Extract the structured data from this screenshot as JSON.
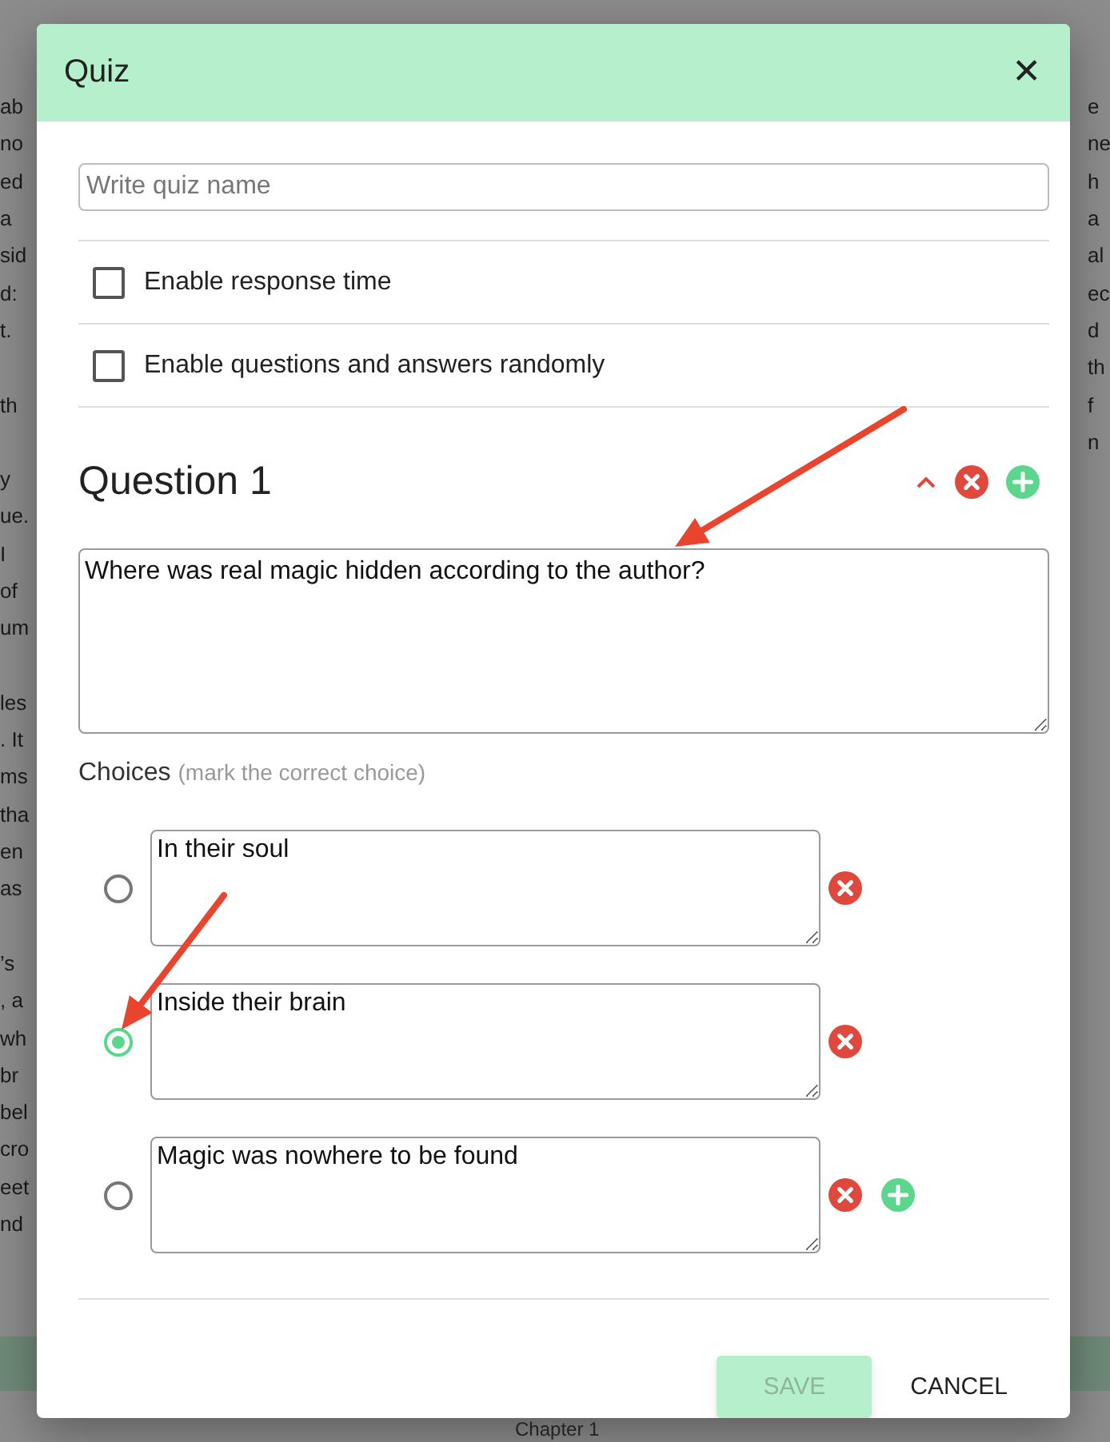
{
  "background": {
    "lines": [
      {
        "left": "ab",
        "right": "e"
      },
      {
        "left": "no",
        "right": "ne"
      },
      {
        "left": "ed",
        "right": "h"
      },
      {
        "left": "a",
        "right": "a"
      },
      {
        "left": "sid",
        "right": "al"
      },
      {
        "left": "d:",
        "right": "ec"
      },
      {
        "left": "t.",
        "right": "d"
      },
      {
        "right": "th"
      },
      {
        "left": "th",
        "right": "f"
      },
      {
        "right": "n"
      },
      {
        "left": "y"
      },
      {
        "left": "ue."
      },
      {
        "left": "I"
      },
      {
        "left": "of"
      },
      {
        "left": "um"
      },
      {
        "left": "les",
        "space_before": true
      },
      {
        "left": ". It"
      },
      {
        "left": "ms"
      },
      {
        "left": "tha"
      },
      {
        "left": "en"
      },
      {
        "left": "as"
      },
      {
        "left": "’s",
        "space_before": true
      },
      {
        "left": ", a"
      },
      {
        "left": "wh"
      },
      {
        "left": "br"
      },
      {
        "left": "bel"
      },
      {
        "left": "cro"
      },
      {
        "left": "eet"
      },
      {
        "left": "nd"
      }
    ],
    "footer_caption": "Chapter 1"
  },
  "dialog": {
    "title": "Quiz",
    "close": "✕",
    "quiz_name": {
      "placeholder": "Write quiz name"
    },
    "options": [
      {
        "label": "Enable response time",
        "checked": false
      },
      {
        "label": "Enable questions and answers randomly",
        "checked": false
      }
    ],
    "question": {
      "title": "Question 1",
      "expanded": true,
      "text": "Where was real magic hidden according to the author?",
      "choices_label": "Choices",
      "choices_hint": "(mark the correct choice)",
      "choices": [
        {
          "text": "In their soul",
          "selected": false
        },
        {
          "text": "Inside their brain",
          "selected": true
        },
        {
          "text": "Magic was nowhere to be found",
          "selected": false
        }
      ]
    },
    "buttons": [
      {
        "label": "SAVE",
        "kind": "primary",
        "disabled": true
      },
      {
        "label": "CANCEL",
        "kind": "text",
        "disabled": false
      }
    ]
  },
  "annotations": [
    {
      "kind": "arrow"
    },
    {
      "kind": "arrow"
    }
  ]
}
